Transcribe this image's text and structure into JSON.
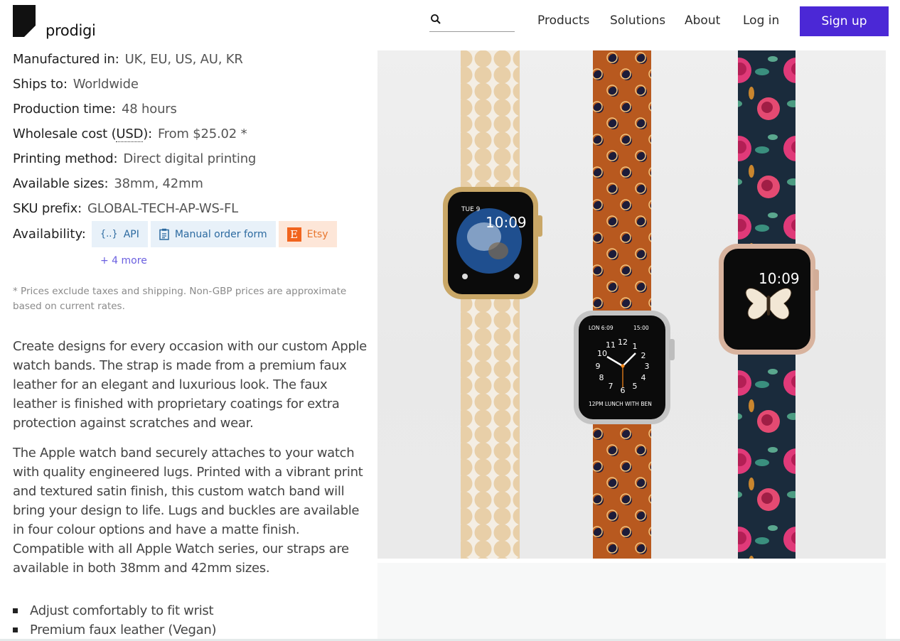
{
  "header": {
    "logo_text": "prodigi",
    "search_placeholder": "",
    "nav": [
      "Products",
      "Solutions",
      "About",
      "Log in"
    ],
    "signup_label": "Sign up",
    "accent_color": "#4b28d6"
  },
  "specs": [
    {
      "label": "Manufactured in:",
      "value": "UK, EU, US, AU, KR"
    },
    {
      "label": "Ships to:",
      "value": "Worldwide"
    },
    {
      "label": "Production time:",
      "value": "48 hours"
    },
    {
      "label_prefix": "Wholesale cost (",
      "label_abbr": "USD",
      "label_suffix": "):",
      "value": "From $25.02 *"
    },
    {
      "label": "Printing method:",
      "value": "Direct digital printing"
    },
    {
      "label": "Available sizes:",
      "value": "38mm, 42mm"
    },
    {
      "label": "SKU prefix:",
      "value": "GLOBAL-TECH-AP-WS-FL"
    }
  ],
  "availability": {
    "label": "Availability:",
    "channels": [
      {
        "icon": "{..}",
        "label": "API"
      },
      {
        "icon": "clipboard-icon",
        "label": "Manual order form"
      },
      {
        "icon": "E",
        "label": "Etsy"
      }
    ],
    "more": "+ 4 more"
  },
  "price_note": "* Prices exclude taxes and shipping. Non-GBP prices are approximate based on current rates.",
  "description": [
    "Create designs for every occasion with our custom Apple watch bands. The strap is made from a premium faux leather for an elegant and luxurious look. The faux leather is finished with proprietary coatings for extra protection against scratches and wear.",
    "The Apple watch band securely attaches to your watch with quality engineered lugs. Printed with a vibrant print and textured satin finish, this custom watch band will bring your design to life. Lugs and buckles are available in four colour options and have a matte finish. Compatible with all Apple Watch series, our straps are available in both 38mm and 42mm sizes."
  ],
  "features": [
    "Adjust comfortably to fit wrist",
    "Premium faux leather (Vegan)"
  ],
  "photo": {
    "watch1": {
      "date": "TUE 9",
      "time": "10:09"
    },
    "watch2": {
      "top_left": "LON 6:09",
      "top_right": "15:00",
      "bottom": "12PM LUNCH WITH BEN",
      "numerals": [
        "12",
        "1",
        "2",
        "3",
        "4",
        "5",
        "6",
        "7",
        "8",
        "9",
        "10",
        "11"
      ]
    },
    "watch3": {
      "time": "10:09"
    }
  }
}
